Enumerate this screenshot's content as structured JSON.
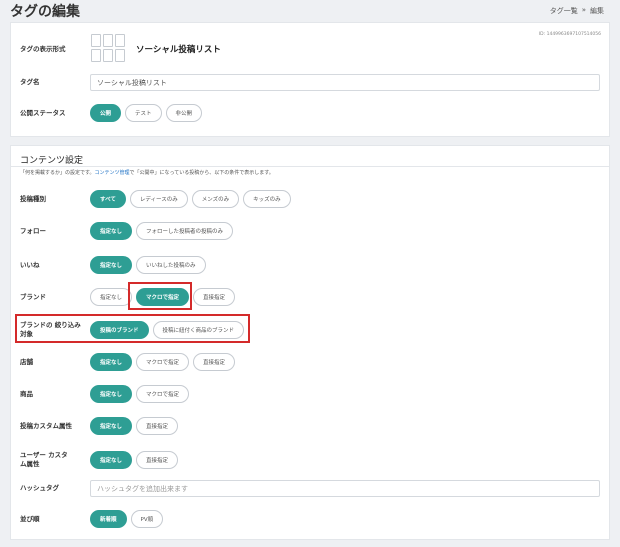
{
  "header": {
    "title": "タグの編集",
    "breadcrumb": [
      "タグ一覧",
      "»",
      "編集"
    ]
  },
  "basic": {
    "tag_id": "ID: 1449963697107514056",
    "format_label": "タグの表示形式",
    "format_value": "ソーシャル投稿リスト",
    "name_label": "タグ名",
    "name_value": "ソーシャル投稿リスト",
    "status_label": "公開ステータス",
    "status_options": [
      "公開",
      "テスト",
      "非公開"
    ]
  },
  "content": {
    "title": "コンテンツ設定",
    "desc_before": "「何を掲載するか」の設定です。",
    "desc_link": "コンテンツ管理",
    "desc_after": "で「公開中」になっている投稿から、以下の条件で表示します。",
    "rows": [
      {
        "label": "投稿種別",
        "options": [
          "すべて",
          "レディースのみ",
          "メンズのみ",
          "キッズのみ"
        ],
        "active": 0
      },
      {
        "label": "フォロー",
        "options": [
          "指定なし",
          "フォローした投稿者の投稿のみ"
        ],
        "active": 0
      },
      {
        "label": "いいね",
        "options": [
          "指定なし",
          "いいねした投稿のみ"
        ],
        "active": 0
      },
      {
        "label": "ブランド",
        "options": [
          "指定なし",
          "マクロで指定",
          "直接指定"
        ],
        "active": 1
      },
      {
        "label": "ブランドの 絞り込み対象",
        "options": [
          "投稿のブランド",
          "投稿に紐付く商品のブランド"
        ],
        "active": 0
      },
      {
        "label": "店舗",
        "options": [
          "指定なし",
          "マクロで指定",
          "直接指定"
        ],
        "active": 0
      },
      {
        "label": "商品",
        "options": [
          "指定なし",
          "マクロで指定"
        ],
        "active": 0
      },
      {
        "label": "投稿カスタム属性",
        "options": [
          "指定なし",
          "直接指定"
        ],
        "active": 0
      },
      {
        "label": "ユーザー カスタム属性",
        "options": [
          "指定なし",
          "直接指定"
        ],
        "active": 0
      }
    ],
    "hashtag_label": "ハッシュタグ",
    "hashtag_placeholder": "ハッシュタグを追加出来ます",
    "sort_label": "並び順",
    "sort_options": [
      "新着順",
      "PV順"
    ]
  },
  "colors": {
    "accent": "#2e9e94",
    "highlight": "#d42a2a",
    "link": "#1a6fc4"
  }
}
